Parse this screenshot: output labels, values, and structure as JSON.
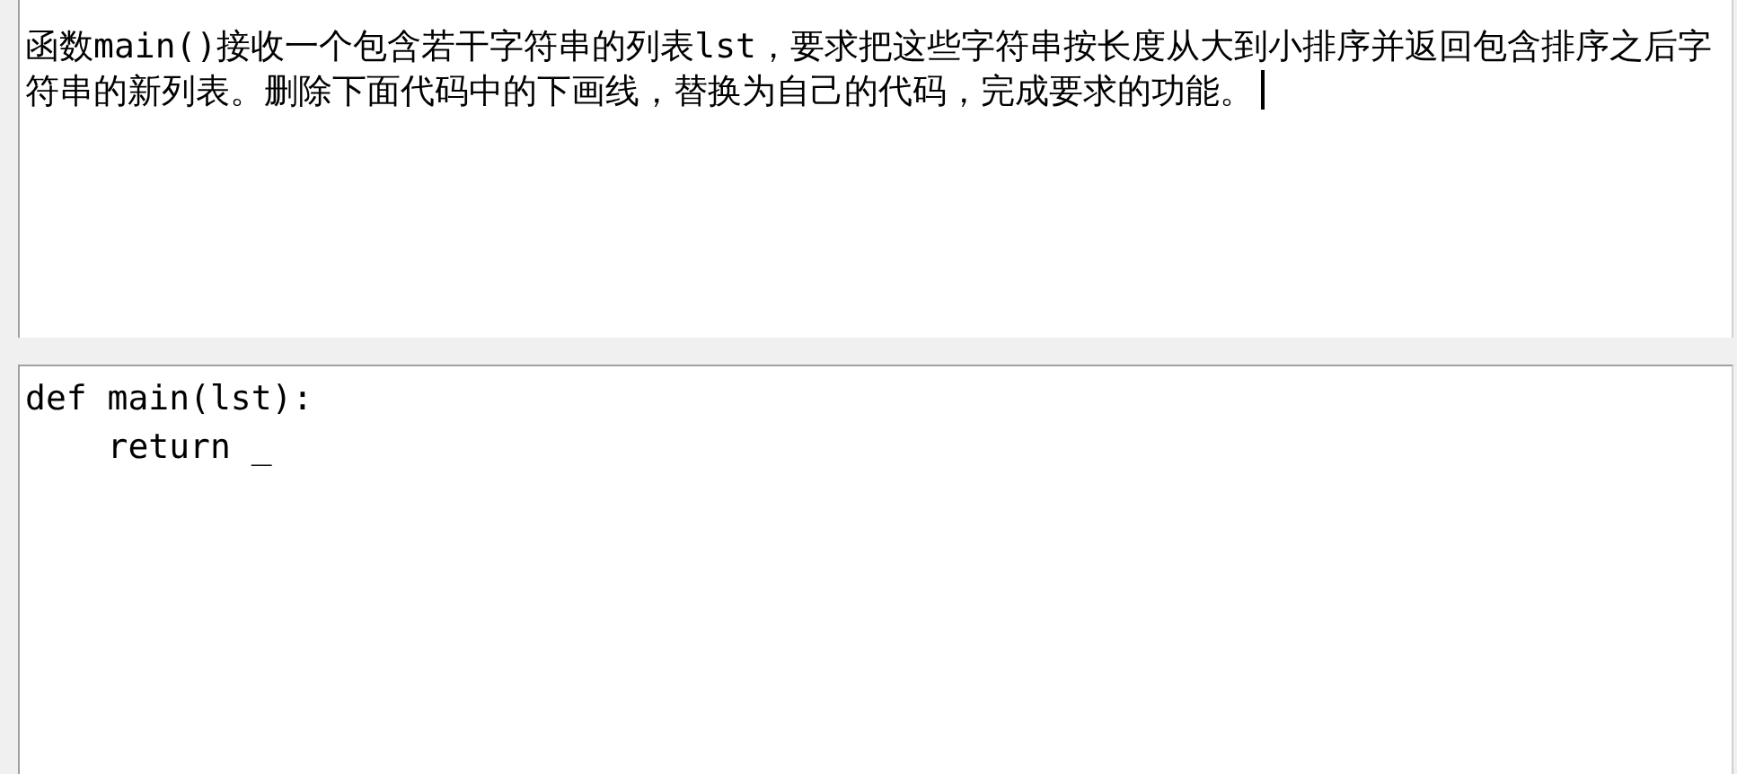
{
  "question": {
    "text": "函数main()接收一个包含若干字符串的列表lst，要求把这些字符串按长度从大到小排序并返回包含排序之后字符串的新列表。删除下面代码中的下画线，替换为自己的代码，完成要求的功能。",
    "focused": true
  },
  "code_editor": {
    "lines": [
      "def main(lst):",
      "    return _"
    ]
  }
}
